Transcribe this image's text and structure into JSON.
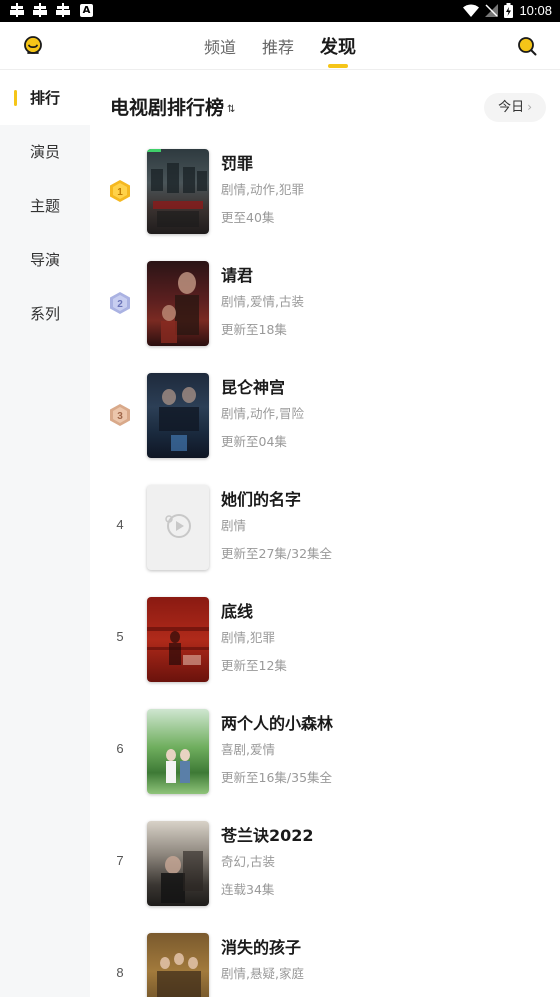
{
  "status_bar": {
    "time": "10:08",
    "a_badge": "A"
  },
  "top_nav": {
    "tabs": [
      {
        "label": "频道",
        "active": false
      },
      {
        "label": "推荐",
        "active": false
      },
      {
        "label": "发现",
        "active": true
      }
    ],
    "left_icon": "badge-smile-icon",
    "right_icon": "search-icon"
  },
  "sidebar": {
    "items": [
      {
        "label": "排行",
        "active": true
      },
      {
        "label": "演员",
        "active": false
      },
      {
        "label": "主题",
        "active": false
      },
      {
        "label": "导演",
        "active": false
      },
      {
        "label": "系列",
        "active": false
      }
    ]
  },
  "main": {
    "title": "电视剧排行榜",
    "sort_glyph": "⇅",
    "today_label": "今日",
    "today_chevron": "›"
  },
  "colors": {
    "accent": "#f5c518",
    "gold": "#f5b820",
    "silver": "#aab2e2",
    "bronze": "#d9a98a"
  },
  "rankings": [
    {
      "rank": "1",
      "medal": "gold",
      "name": "罚罪",
      "genre": "剧情,动作,犯罪",
      "episodes": "更至40集"
    },
    {
      "rank": "2",
      "medal": "silver",
      "name": "请君",
      "genre": "剧情,爱情,古装",
      "episodes": "更新至18集"
    },
    {
      "rank": "3",
      "medal": "bronze",
      "name": "昆仑神宫",
      "genre": "剧情,动作,冒险",
      "episodes": "更新至04集"
    },
    {
      "rank": "4",
      "medal": "",
      "name": "她们的名字",
      "genre": "剧情",
      "episodes": "更新至27集/32集全"
    },
    {
      "rank": "5",
      "medal": "",
      "name": "底线",
      "genre": "剧情,犯罪",
      "episodes": "更新至12集"
    },
    {
      "rank": "6",
      "medal": "",
      "name": "两个人的小森林",
      "genre": "喜剧,爱情",
      "episodes": "更新至16集/35集全"
    },
    {
      "rank": "7",
      "medal": "",
      "name": "苍兰诀2022",
      "genre": "奇幻,古装",
      "episodes": "连载34集"
    },
    {
      "rank": "8",
      "medal": "",
      "name": "消失的孩子",
      "genre": "剧情,悬疑,家庭",
      "episodes": ""
    }
  ]
}
